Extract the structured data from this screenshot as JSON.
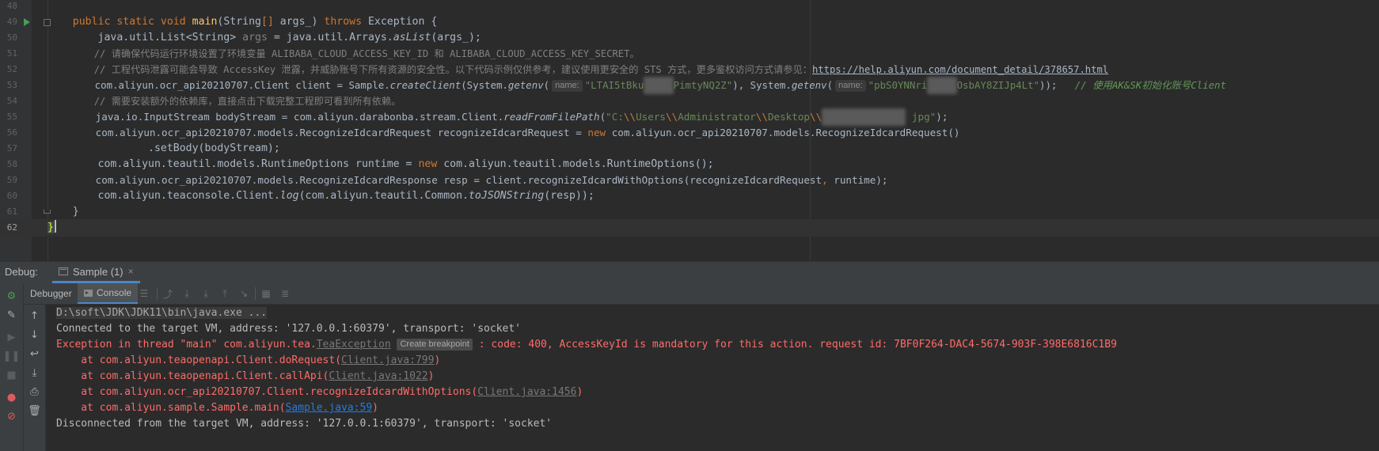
{
  "editor": {
    "lines": [
      {
        "n": "48"
      },
      {
        "n": "49"
      },
      {
        "n": "50"
      },
      {
        "n": "51"
      },
      {
        "n": "52"
      },
      {
        "n": "53"
      },
      {
        "n": "54"
      },
      {
        "n": "55"
      },
      {
        "n": "56"
      },
      {
        "n": "57"
      },
      {
        "n": "58"
      },
      {
        "n": "59"
      },
      {
        "n": "60"
      },
      {
        "n": "61"
      },
      {
        "n": "62"
      }
    ],
    "l49": {
      "indent": "    ",
      "kw1": "public static void ",
      "fn": "main",
      "p1": "(String",
      "br": "[]",
      "p2": " args_) ",
      "kw2": "throws",
      "p3": " Exception {"
    },
    "l50": {
      "text1": "        java.util.List<String> ",
      "var": "args",
      "text2": " = java.util.Arrays.",
      "call": "asList",
      "text3": "(args_);"
    },
    "l51": "        // 请确保代码运行环境设置了环境变量 ALIBABA_CLOUD_ACCESS_KEY_ID 和 ALIBABA_CLOUD_ACCESS_KEY_SECRET。",
    "l52": {
      "comment": "        // 工程代码泄露可能会导致 AccessKey 泄露，并威胁账号下所有资源的安全性。以下代码示例仅供参考，建议使用更安全的 STS 方式，更多鉴权访问方式请参见：",
      "url": "https://help.aliyun.com/document_detail/378657.html"
    },
    "l53": {
      "t1": "        com.aliyun.ocr_api20210707.Client client = Sample.",
      "c1": "createClient",
      "t2": "(System.",
      "c2": "getenv",
      "t3": "(",
      "hint1": "name:",
      "s1a": "\"LTAI5tBku",
      "s1b": "PimtyNQ2Z\"",
      "t4": "), System.",
      "c3": "getenv",
      "t5": "(",
      "hint2": "name:",
      "s2a": "\"pbS0YNNri",
      "s2b": "OsbAY8ZIJp4Lt\"",
      "t6": "));   ",
      "tail": "// 使用AK&SK初始化账号Client"
    },
    "l54": "        // 需要安装额外的依赖库，直接点击下载完整工程即可看到所有依赖。",
    "l55": {
      "t1": "        java.io.InputStream bodyStream = com.aliyun.darabonba.stream.Client.",
      "call": "readFromFilePath",
      "t2": "(",
      "s1": "\"C:",
      "esc1": "\\\\",
      "s2": "Users",
      "esc2": "\\\\",
      "s3": "Administrator",
      "esc3": "\\\\",
      "s4": "Desktop",
      "esc4": "\\\\",
      "s5": " jpg\"",
      "t3": ");"
    },
    "l56": {
      "t1": "        com.aliyun.ocr_api20210707.models.RecognizeIdcardRequest recognizeIdcardRequest = ",
      "kw": "new",
      "t2": " com.aliyun.ocr_api20210707.models.RecognizeIdcardRequest()"
    },
    "l57": "                .setBody(bodyStream);",
    "l58": {
      "t1": "        com.aliyun.teautil.models.RuntimeOptions runtime = ",
      "kw": "new",
      "t2": " com.aliyun.teautil.models.RuntimeOptions();"
    },
    "l59": {
      "t1": "        com.aliyun.ocr_api20210707.models.RecognizeIdcardResponse resp = client.recognizeIdcardWithOptions(recognizeIdcardRequest",
      "comma": ",",
      "t2": " runtime);"
    },
    "l60": {
      "t1": "        com.aliyun.teaconsole.Client.",
      "call1": "log",
      "t2": "(com.aliyun.teautil.Common.",
      "call2": "toJSONString",
      "t3": "(resp));"
    },
    "l61": "    }",
    "l62": "}"
  },
  "debug": {
    "title": "Debug:",
    "tab_label": "Sample (1)",
    "close": "×",
    "subtabs": {
      "debugger": "Debugger",
      "console": "Console"
    }
  },
  "console": {
    "cmd": "D:\\soft\\JDK\\JDK11\\bin\\java.exe ...",
    "connected": "Connected to the target VM, address: '127.0.0.1:60379', transport: 'socket'",
    "exc_prefix": "Exception in thread \"main\" com.aliyun.tea.",
    "exc_class": "TeaException",
    "bp_hint": "Create breakpoint",
    "exc_msg": " : code: 400, AccessKeyId is mandatory for this action. request id: 7BF0F264-DAC4-5674-903F-398E6816C1B9",
    "stack": [
      {
        "prefix": "    at com.aliyun.teaopenapi.Client.doRequest(",
        "link": "Client.java:799",
        "suffix": ")"
      },
      {
        "prefix": "    at com.aliyun.teaopenapi.Client.callApi(",
        "link": "Client.java:1022",
        "suffix": ")"
      },
      {
        "prefix": "    at com.aliyun.ocr_api20210707.Client.recognizeIdcardWithOptions(",
        "link": "Client.java:1456",
        "suffix": ")"
      },
      {
        "prefix": "    at com.aliyun.sample.Sample.main(",
        "link": "Sample.java:59",
        "suffix": ")"
      }
    ],
    "disconnected": "Disconnected from the target VM, address: '127.0.0.1:60379', transport: 'socket'"
  }
}
